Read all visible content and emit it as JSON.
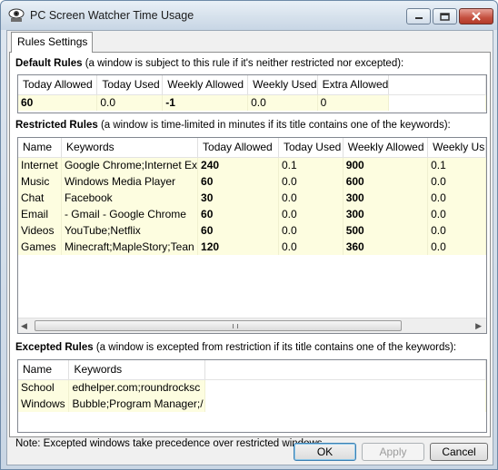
{
  "window": {
    "title": "PC Screen Watcher Time Usage",
    "icons": {
      "app": "eye-icon",
      "minimize": "minimize-icon",
      "maximize": "maximize-icon",
      "close": "close-icon"
    }
  },
  "tabs": {
    "active": "Rules Settings"
  },
  "default_rules": {
    "heading": "Default Rules",
    "description": " (a window is subject to this rule if it's neither restricted nor excepted):",
    "columns": [
      "Today Allowed",
      "Today Used",
      "Weekly Allowed",
      "Weekly Used",
      "Extra Allowed"
    ],
    "values": [
      "60",
      "0.0",
      "-1",
      "0.0",
      "0"
    ]
  },
  "restricted_rules": {
    "heading": "Restricted Rules",
    "description": " (a window is time-limited in minutes if its title contains one of the keywords):",
    "columns": [
      "Name",
      "Keywords",
      "Today Allowed",
      "Today Used",
      "Weekly Allowed",
      "Weekly Us"
    ],
    "rows": [
      [
        "Internet",
        "Google Chrome;Internet Ex",
        "240",
        "0.1",
        "900",
        "0.1"
      ],
      [
        "Music",
        "Windows Media Player",
        "60",
        "0.0",
        "600",
        "0.0"
      ],
      [
        "Chat",
        "Facebook",
        "30",
        "0.0",
        "300",
        "0.0"
      ],
      [
        "Email",
        "- Gmail - Google Chrome",
        "60",
        "0.0",
        "300",
        "0.0"
      ],
      [
        "Videos",
        "YouTube;Netflix",
        "60",
        "0.0",
        "500",
        "0.0"
      ],
      [
        "Games",
        "Minecraft;MapleStory;Tean",
        "120",
        "0.0",
        "360",
        "0.0"
      ]
    ]
  },
  "excepted_rules": {
    "heading": "Excepted Rules",
    "description": " (a window is excepted from restriction if its title contains one of the keywords):",
    "columns": [
      "Name",
      "Keywords"
    ],
    "rows": [
      [
        "School",
        "edhelper.com;roundrocksc"
      ],
      [
        "Windows",
        "Bubble;Program Manager;/"
      ]
    ]
  },
  "note": "Note: Excepted windows take precedence over restricted windows.",
  "buttons": {
    "ok": "OK",
    "apply": "Apply",
    "cancel": "Cancel"
  }
}
